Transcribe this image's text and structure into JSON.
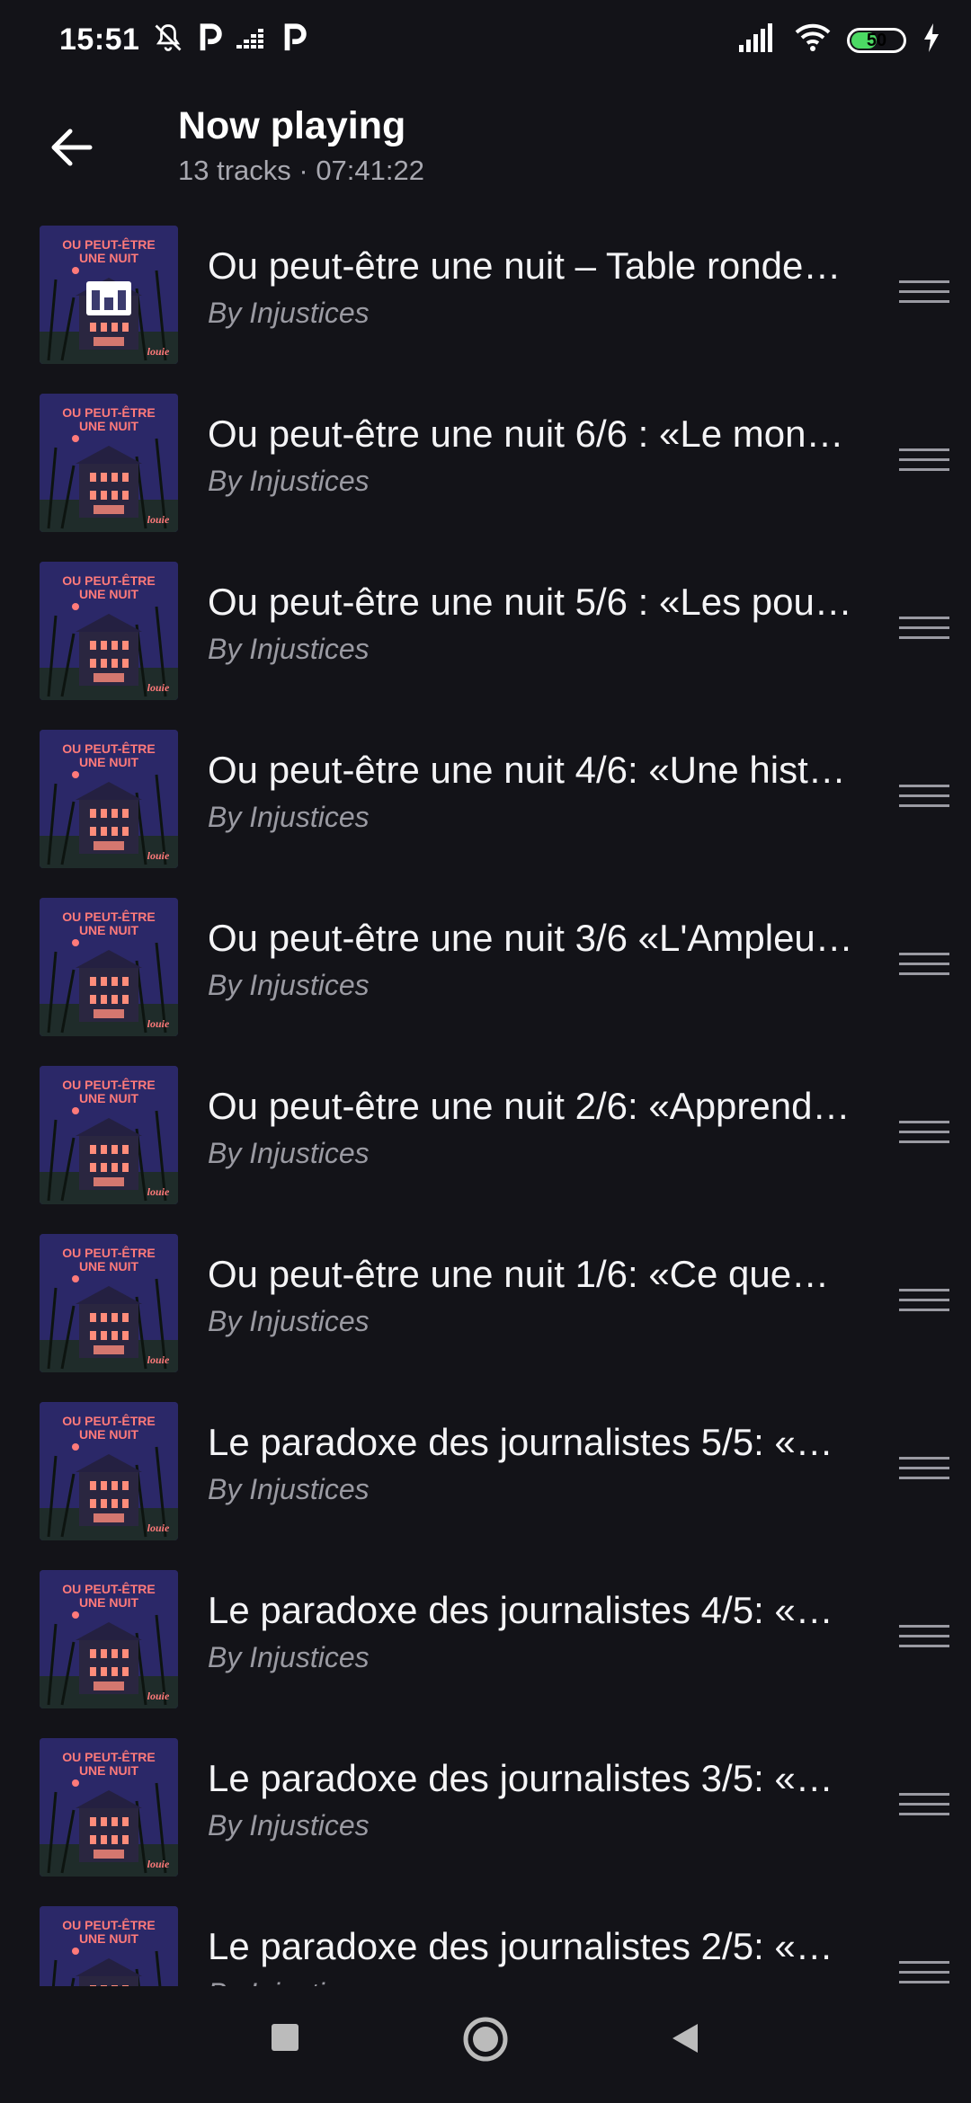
{
  "status_bar": {
    "time": "15:51",
    "battery": "50",
    "icons": [
      "bell-off-icon",
      "p-app-icon",
      "deezer-icon",
      "p-app-icon",
      "signal-icon",
      "wifi-icon",
      "battery-icon",
      "charging-icon"
    ]
  },
  "header": {
    "title": "Now playing",
    "subtitle": "13 tracks · 07:41:22"
  },
  "tracks": [
    {
      "title": "Ou peut-être une nuit – Table ronde…",
      "artist": "By Injustices",
      "playing": true
    },
    {
      "title": "Ou peut-être une nuit 6/6 : «Le mon…",
      "artist": "By Injustices"
    },
    {
      "title": "Ou peut-être une nuit 5/6 : «Les pou…",
      "artist": "By Injustices"
    },
    {
      "title": "Ou peut-être une nuit 4/6: «Une hist…",
      "artist": "By Injustices"
    },
    {
      "title": "Ou peut-être une nuit 3/6 «L'Ampleur…",
      "artist": "By Injustices"
    },
    {
      "title": "Ou peut-être une nuit 2/6: «Apprend…",
      "artist": "By Injustices"
    },
    {
      "title": "Ou peut-être une nuit 1/6: «Ce que…",
      "artist": "By Injustices"
    },
    {
      "title": "Le paradoxe des journalistes 5/5: «…",
      "artist": "By Injustices"
    },
    {
      "title": "Le paradoxe des journalistes 4/5: «…",
      "artist": "By Injustices"
    },
    {
      "title": "Le paradoxe des journalistes 3/5: «…",
      "artist": "By Injustices"
    },
    {
      "title": "Le paradoxe des journalistes 2/5: «…",
      "artist": "By Injustices"
    }
  ],
  "artwork": {
    "line1": "OU PEUT-ÊTRE",
    "line2": "UNE NUIT",
    "brand": "louie"
  },
  "colors": {
    "background": "#131318",
    "artwork_bg": "#2b2868",
    "artwork_title": "#ff7a7a",
    "window_glow": "#ff8c7a"
  }
}
